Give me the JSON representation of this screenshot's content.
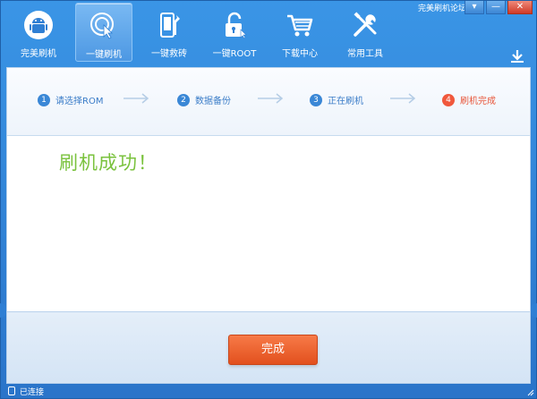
{
  "titlebar": {
    "forum_link": "完美刷机论坛",
    "buttons": {
      "menu": "▾",
      "minimize": "—",
      "close": "✕"
    }
  },
  "toolbar": {
    "items": [
      {
        "label": "完美刷机",
        "icon": "android-icon"
      },
      {
        "label": "一键刷机",
        "icon": "tap-phone-icon",
        "active": true
      },
      {
        "label": "一键救砖",
        "icon": "repair-phone-icon"
      },
      {
        "label": "一键ROOT",
        "icon": "unlock-icon"
      },
      {
        "label": "下载中心",
        "icon": "cart-icon"
      },
      {
        "label": "常用工具",
        "icon": "tools-icon"
      }
    ]
  },
  "steps": [
    {
      "num": "1",
      "label": "请选择ROM"
    },
    {
      "num": "2",
      "label": "数据备份"
    },
    {
      "num": "3",
      "label": "正在刷机"
    },
    {
      "num": "4",
      "label": "刷机完成",
      "current": true
    }
  ],
  "message": "刷机成功！",
  "footer": {
    "finish_label": "完成"
  },
  "status": {
    "text": "已连接"
  },
  "colors": {
    "accent": "#2f7fd4",
    "success_text": "#7ac23d",
    "finish_button": "#e8592a",
    "step_done": "#f0583c"
  }
}
